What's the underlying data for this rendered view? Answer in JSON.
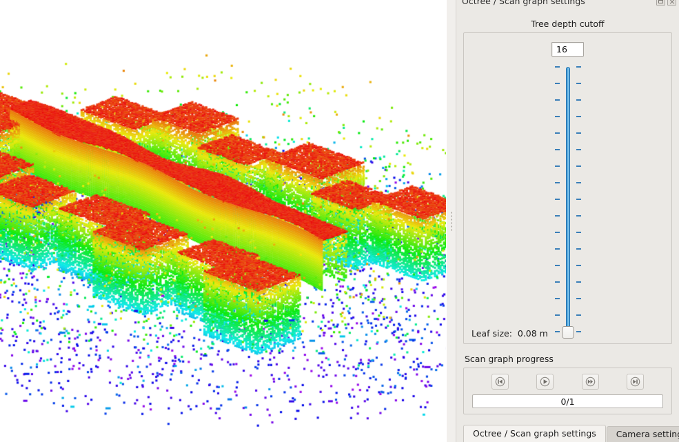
{
  "dock": {
    "title": "Octree / Scan graph settings",
    "window_buttons": [
      {
        "name": "undock-button",
        "icon": "undock-icon"
      },
      {
        "name": "close-button",
        "icon": "close-icon"
      }
    ]
  },
  "tree_depth": {
    "group_title": "Tree depth cutoff",
    "spin_value": "16",
    "slider": {
      "min": 0,
      "max": 16,
      "value": 0,
      "orientation": "vertical",
      "tick_count": 17,
      "groove_color": "#3b93cf",
      "handle_color": "#f0efec"
    },
    "leaf_size_label": "Leaf size:  0.08 m"
  },
  "scan_graph": {
    "group_title": "Scan graph progress",
    "buttons": [
      {
        "name": "skip-to-start-button",
        "icon": "skip-back-icon",
        "label": "Skip to start"
      },
      {
        "name": "play-button",
        "icon": "play-icon",
        "label": "Play"
      },
      {
        "name": "fast-forward-button",
        "icon": "fast-forward-icon",
        "label": "Fast forward"
      },
      {
        "name": "skip-to-end-button",
        "icon": "skip-forward-icon",
        "label": "Skip to end"
      }
    ],
    "progress_text": "0/1",
    "progress_value": 0,
    "progress_max": 1
  },
  "tabs": [
    {
      "label": "Octree / Scan graph settings",
      "active": true
    },
    {
      "label": "Camera settings",
      "active": false
    }
  ],
  "viewport": {
    "name": "3d-octomap-viewport",
    "background": "#ffffff",
    "description": "3D octree voxel map of an urban street scene, height-coloured rainbow"
  },
  "splitter": {
    "name": "panel-splitter",
    "orientation": "vertical"
  }
}
